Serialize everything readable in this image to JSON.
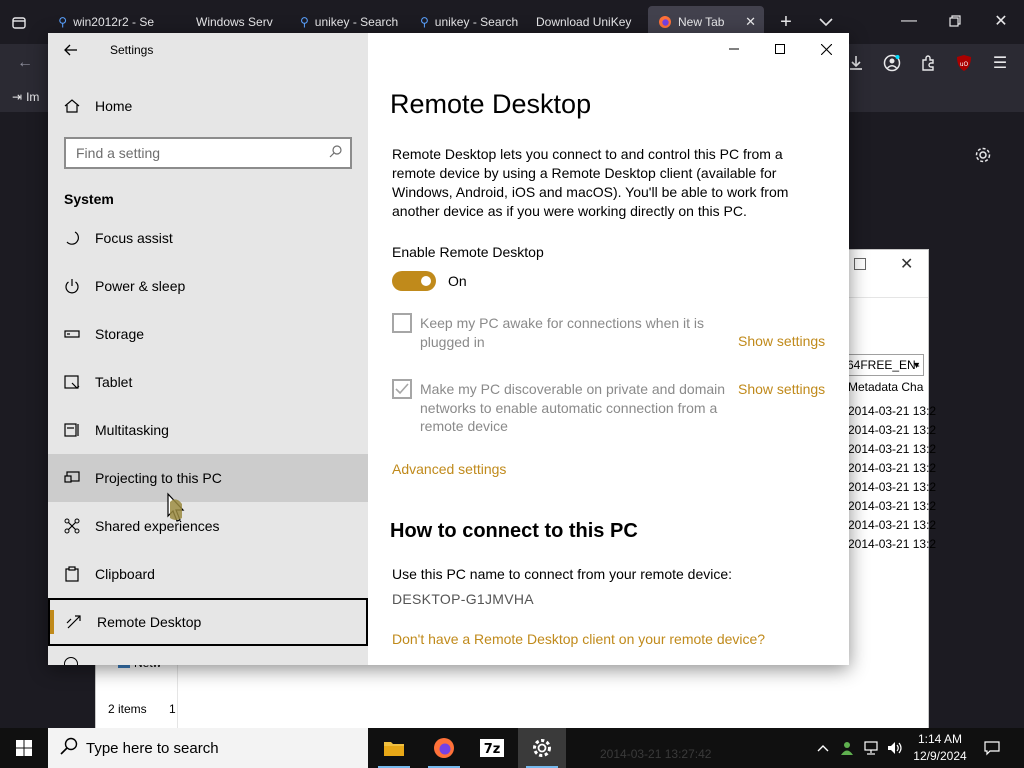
{
  "browser": {
    "tabs": [
      {
        "label": "win2012r2 - Se",
        "icon": "search-icon"
      },
      {
        "label": "Windows Serv",
        "icon": ""
      },
      {
        "label": "unikey - Search",
        "icon": "search-icon"
      },
      {
        "label": "unikey - Search",
        "icon": "search-icon"
      },
      {
        "label": "Download UniKey",
        "icon": ""
      },
      {
        "label": "New Tab",
        "icon": "firefox-icon"
      }
    ],
    "bookmark_import": "Im"
  },
  "explorer": {
    "combo": "64FREE_EN-",
    "column_header": "Metadata Cha",
    "rows": [
      "2014-03-21 13:2",
      "2014-03-21 13:2",
      "2014-03-21 13:2",
      "2014-03-21 13:2",
      "2014-03-21 13:2",
      "2014-03-21 13:2",
      "2014-03-21 13:2",
      "2014-03-21 13:2"
    ],
    "status": "2 items",
    "status_extra": "1",
    "partial_label": "Netw"
  },
  "settings": {
    "window_title": "Settings",
    "home": "Home",
    "search_placeholder": "Find a setting",
    "section": "System",
    "nav": [
      {
        "label": "Focus assist",
        "icon": "moon-icon"
      },
      {
        "label": "Power & sleep",
        "icon": "power-icon"
      },
      {
        "label": "Storage",
        "icon": "storage-icon"
      },
      {
        "label": "Tablet",
        "icon": "tablet-icon"
      },
      {
        "label": "Multitasking",
        "icon": "multitasking-icon"
      },
      {
        "label": "Projecting to this PC",
        "icon": "projecting-icon"
      },
      {
        "label": "Shared experiences",
        "icon": "shared-experiences-icon"
      },
      {
        "label": "Clipboard",
        "icon": "clipboard-icon"
      },
      {
        "label": "Remote Desktop",
        "icon": "remote-desktop-icon"
      }
    ],
    "page": {
      "title": "Remote Desktop",
      "description": "Remote Desktop lets you connect to and control this PC from a remote device by using a Remote Desktop client (available for Windows, Android, iOS and macOS). You'll be able to work from another device as if you were working directly on this PC.",
      "enable_label": "Enable Remote Desktop",
      "toggle_state": "On",
      "toggle_on": true,
      "keep_awake": "Keep my PC awake for connections when it is plugged in",
      "keep_awake_checked": false,
      "discoverable": "Make my PC discoverable on private and domain networks to enable automatic connection from a remote device",
      "discoverable_checked": true,
      "show_settings": "Show settings",
      "advanced": "Advanced settings",
      "how_to_title": "How to connect to this PC",
      "use_name": "Use this PC name to connect from your remote device:",
      "pc_name": "DESKTOP-G1JMVHA",
      "no_client": "Don't have a Remote Desktop client on your remote device?"
    },
    "accent_color": "#c08a1b"
  },
  "taskbar": {
    "search_text": "Type here to search",
    "time": "1:14 AM",
    "date": "12/9/2024",
    "behind_text": "2014-03-21 13:27:42"
  }
}
